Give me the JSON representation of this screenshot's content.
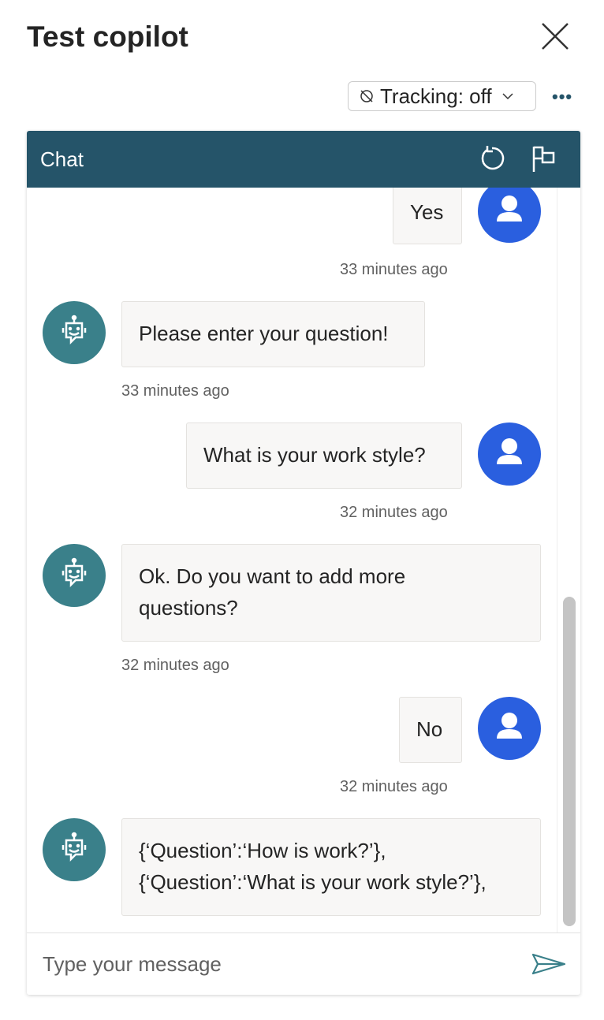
{
  "header": {
    "title": "Test copilot",
    "tracking_label": "Tracking: off",
    "more_label": "•••"
  },
  "chat": {
    "title": "Chat",
    "messages": [
      {
        "sender": "user",
        "text": "Yes",
        "time": "33 minutes ago"
      },
      {
        "sender": "bot",
        "text": "Please enter your question!",
        "time": "33 minutes ago"
      },
      {
        "sender": "user",
        "text": "What is your work style?",
        "time": "32 minutes ago"
      },
      {
        "sender": "bot",
        "text": "Ok. Do you want to add more questions?",
        "time": "32 minutes ago"
      },
      {
        "sender": "user",
        "text": "No",
        "time": "32 minutes ago"
      },
      {
        "sender": "bot",
        "text": "{‘Question’:‘How is work?’}, {‘Question’:‘What is your work style?’},"
      }
    ],
    "input_placeholder": "Type your message"
  },
  "colors": {
    "header": "#255469",
    "user_avatar": "#2a5fdf",
    "bot_avatar": "#3a808a"
  }
}
